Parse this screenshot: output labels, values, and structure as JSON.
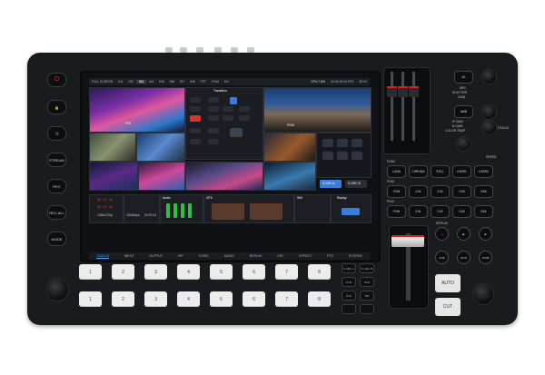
{
  "topbar": {
    "tabs": [
      "FULL SCREEN",
      "IN1",
      "IN2",
      "IN3",
      "IN4",
      "IN5",
      "IN6",
      "IN7",
      "IN8",
      "PST",
      "PGM",
      "MV"
    ],
    "selected": 3,
    "cpu": "CPU:7.8%",
    "clock": "00:00:00:00 FPS",
    "fps": "59.94"
  },
  "panel": {
    "transition": "Transition",
    "pst": "PST",
    "pgm": "PGM",
    "sgrc_a": "S-SRC A",
    "sgrc_b": "S-SRC B"
  },
  "controls": {
    "audio": "Audio",
    "gfx": "GFX",
    "still": "Still",
    "replay": "Replay",
    "rec1": "00 : 07 : 24",
    "rec2": "00 : 07 : 24",
    "res": "1280x720p",
    "bitrate": "1024kbps",
    "time": "00:37:24"
  },
  "statusbar": [
    "STATUS",
    "INPUT",
    "OUTPUT",
    "PIP",
    "S-SRC",
    "AUDIO",
    "REPLAY",
    "KEY",
    "EFFECT",
    "PTZ",
    "SYSTEM"
  ],
  "statusbar_active": 0,
  "sidebuttons": [
    "",
    "",
    "",
    "STREAM",
    "REC",
    "REC ALL",
    "MODE"
  ],
  "keypad": {
    "row1": [
      "1",
      "2",
      "3",
      "4",
      "5",
      "6",
      "7",
      "8"
    ],
    "row2": [
      "1",
      "2",
      "3",
      "4",
      "5",
      "6",
      "7",
      "8"
    ]
  },
  "smallkeys": [
    "S-SRC A",
    "S-SRC B",
    "FTB",
    "DSK",
    "PTZ",
    "PIP"
  ],
  "right": {
    "top": [
      "A/I",
      "AWB"
    ],
    "iris_labels": [
      "IRIS",
      "SHUTTER",
      "GAIN"
    ],
    "gain_labels": [
      "R GAIN",
      "B GAIN",
      "COLOR TEMP"
    ],
    "focus": "FOCUS",
    "speed": "SPEED",
    "func_label": "FUNC",
    "func": [
      "LUMA",
      "CHROMA",
      "STILL",
      "USER1",
      "USER2"
    ],
    "pgm_label": "PGM",
    "pgm": [
      "PGM",
      "CH1",
      "CH2",
      "CH3",
      "DSK"
    ],
    "pvw_label": "PVW",
    "pvw": [
      "PVW",
      "CH1",
      "CH2",
      "CH3",
      "DSK"
    ],
    "replay_label": "REPLAY",
    "replay": [
      "CUE",
      "RUN",
      "JUMP"
    ],
    "auto": "AUTO",
    "cut": "CUT"
  },
  "colors": {
    "body": "#1a1b1e",
    "accent": "#4aa3ff",
    "tbar_red": "#d92323"
  }
}
